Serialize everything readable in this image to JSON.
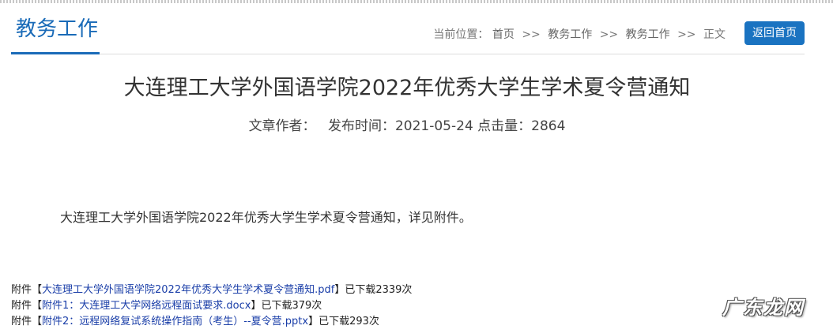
{
  "header": {
    "section_title": "教务工作",
    "breadcrumb": {
      "prefix": "当前位置：",
      "items": [
        "首页",
        "教务工作",
        "教务工作",
        "正文"
      ],
      "separator": ">>"
    },
    "back_button": "返回首页"
  },
  "article": {
    "title": "大连理工大学外国语学院2022年优秀大学生学术夏令营通知",
    "meta": {
      "author_label": "文章作者：",
      "date_label": "发布时间：",
      "date": "2021-05-24",
      "views_label": "点击量：",
      "views": "2864"
    },
    "body": "大连理工大学外国语学院2022年优秀大学生学术夏令营通知，详见附件。"
  },
  "attachments": [
    {
      "prefix": "附件【",
      "name": "大连理工大学外国语学院2022年优秀大学生学术夏令营通知.pdf",
      "suffix": "】已下载2339次"
    },
    {
      "prefix": "附件【",
      "name": "附件1：大连理工大学网络远程面试要求.docx",
      "suffix": "】已下载379次"
    },
    {
      "prefix": "附件【",
      "name": "附件2：远程网络复试系统操作指南（考生）--夏令营.pptx",
      "suffix": "】已下载293次"
    }
  ],
  "watermark": "广东龙网",
  "colors": {
    "accent": "#1a6bb8",
    "button": "#1a73c1",
    "link": "#1a3ea8"
  }
}
